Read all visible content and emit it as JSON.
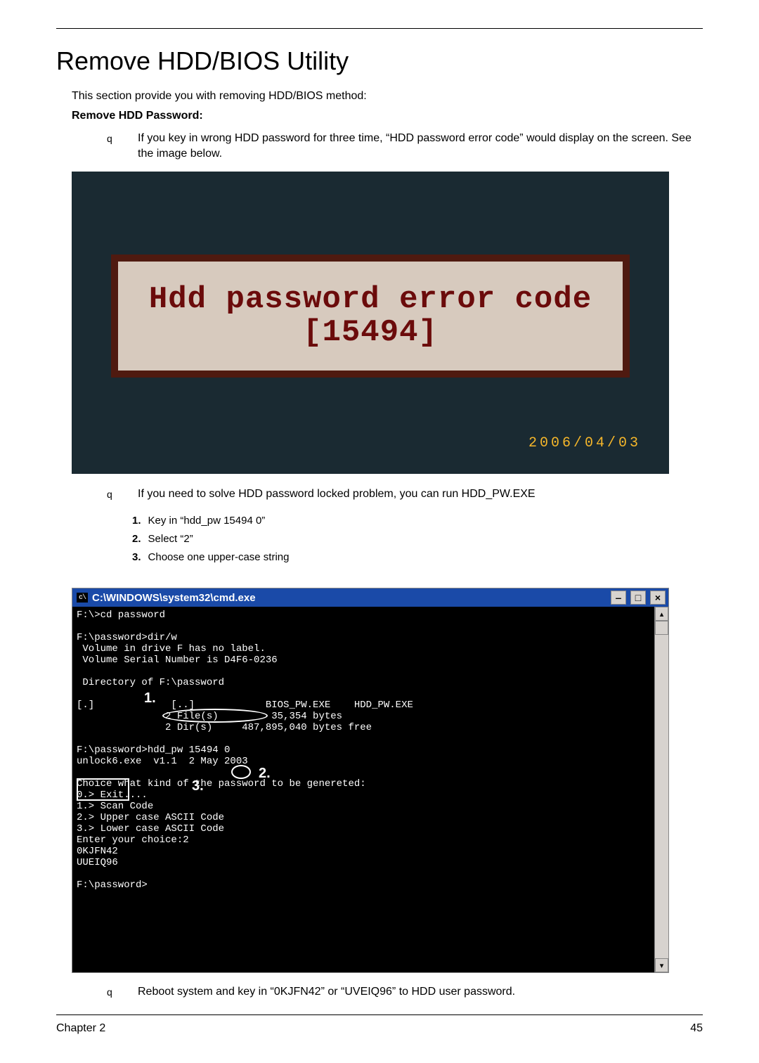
{
  "title": "Remove HDD/BIOS Utility",
  "intro": "This section provide you with removing HDD/BIOS method:",
  "subhead": "Remove HDD Password:",
  "bullets": {
    "b1": "If you key in wrong HDD password for three time, “HDD password error code” would display on the screen. See the image below.",
    "b2": "If you need to solve HDD password locked problem, you can run HDD_PW.EXE",
    "b3": "Reboot system and key in “0KJFN42” or “UVEIQ96” to HDD user password."
  },
  "figure1": {
    "line1": "Hdd password error code",
    "line2": "[15494]",
    "date": "2006/04/03"
  },
  "steps": {
    "n1": "1.",
    "s1": "Key in “hdd_pw 15494 0”",
    "n2": "2.",
    "s2": "Select “2”",
    "n3": "3.",
    "s3": "Choose one upper-case string"
  },
  "cmd": {
    "title_prefix": "C:\\\\",
    "title": "C:\\WINDOWS\\system32\\cmd.exe",
    "body": "F:\\>cd password\n\nF:\\password>dir/w\n Volume in drive F has no label.\n Volume Serial Number is D4F6-0236\n\n Directory of F:\\password\n\n[.]             [..]            BIOS_PW.EXE    HDD_PW.EXE\n               2 File(s)         35,354 bytes\n               2 Dir(s)     487,895,040 bytes free\n\nF:\\password>hdd_pw 15494 0\nunlock6.exe  v1.1  2 May 2003\n\nChoice what kind of the password to be genereted:\n0.> Exit....\n1.> Scan Code\n2.> Upper case ASCII Code\n3.> Lower case ASCII Code\nEnter your choice:2\n0KJFN42\nUUEIQ96\n\nF:\\password>",
    "annot1": "1.",
    "annot2": "2.",
    "annot3": "3."
  },
  "footer": {
    "left": "Chapter 2",
    "right": "45"
  },
  "q": "q"
}
